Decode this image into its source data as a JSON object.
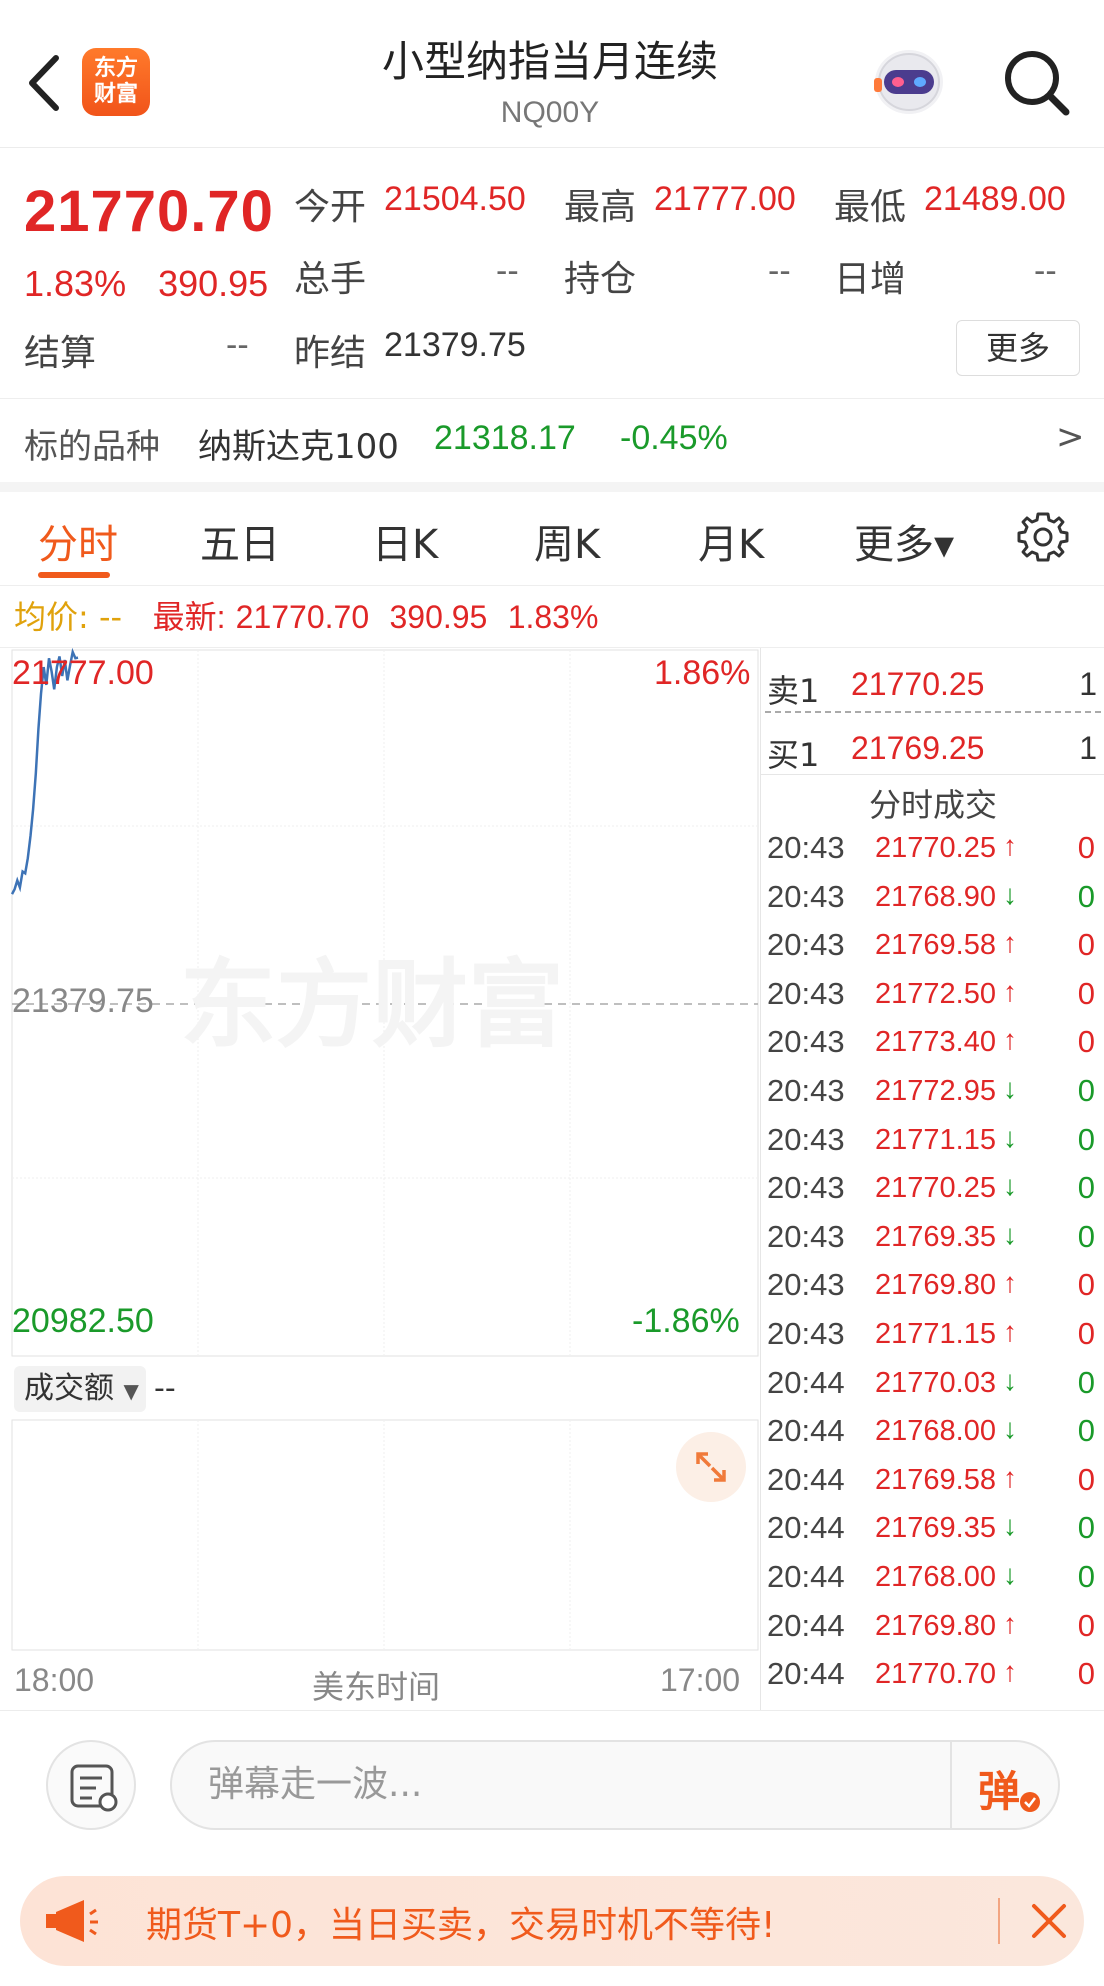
{
  "header": {
    "title": "小型纳指当月连续",
    "subtitle": "NQ00Y",
    "logo_line1": "东方",
    "logo_line2": "财富"
  },
  "quote": {
    "last_price": "21770.70",
    "change_pct": "1.83%",
    "change_abs": "390.95",
    "open_label": "今开",
    "open_value": "21504.50",
    "high_label": "最高",
    "high_value": "21777.00",
    "low_label": "最低",
    "low_value": "21489.00",
    "volume_label": "总手",
    "volume_value": "--",
    "oi_label": "持仓",
    "oi_value": "--",
    "daily_inc_label": "日增",
    "daily_inc_value": "--",
    "settle_label": "结算",
    "settle_value": "--",
    "prev_settle_label": "昨结",
    "prev_settle_value": "21379.75",
    "more_label": "更多"
  },
  "underlying": {
    "label": "标的品种",
    "name": "纳斯达克100",
    "price": "21318.17",
    "change": "-0.45%",
    "arrow": ">"
  },
  "tabs": [
    {
      "label": "分时",
      "active": true
    },
    {
      "label": "五日"
    },
    {
      "label": "日K"
    },
    {
      "label": "周K"
    },
    {
      "label": "月K"
    },
    {
      "label": "更多▾"
    }
  ],
  "avg_line": {
    "avg_label": "均价:",
    "avg_value": "--",
    "latest_label": "最新:",
    "latest_price": "21770.70",
    "latest_change": "390.95",
    "latest_pct": "1.83%"
  },
  "chart": {
    "y_top": "21777.00",
    "y_mid": "21379.75",
    "y_bottom": "20982.50",
    "pct_top": "1.86%",
    "pct_bottom": "-1.86%",
    "watermark": "东方财富",
    "line_color": "#3d73b6"
  },
  "chart_data": {
    "type": "line",
    "title": "",
    "ylim": [
      20982.5,
      21777.0
    ],
    "reference": 21379.75,
    "x": [
      0,
      1,
      2,
      3,
      4,
      5,
      6,
      7,
      8,
      9,
      10,
      11,
      12,
      13,
      14,
      15,
      16,
      17,
      18,
      19,
      20,
      21,
      22,
      23,
      24,
      25
    ],
    "values": [
      21504.5,
      21510,
      21520,
      21512,
      21530,
      21528,
      21545,
      21570,
      21600,
      21640,
      21690,
      21730,
      21760,
      21740,
      21770,
      21755,
      21735,
      21760,
      21772,
      21750,
      21768,
      21745,
      21762,
      21777,
      21770,
      21770.7
    ]
  },
  "volume": {
    "select_label": "成交额",
    "value": "--"
  },
  "time_axis": {
    "start": "18:00",
    "middle": "美东时间",
    "end": "17:00"
  },
  "orderbook": {
    "ask_label": "卖1",
    "ask_price": "21770.25",
    "ask_qty": "1",
    "bid_label": "买1",
    "bid_price": "21769.25",
    "bid_qty": "1"
  },
  "ticks": {
    "title": "分时成交",
    "rows": [
      {
        "time": "20:43",
        "price": "21770.25",
        "dir": "up",
        "vol": "0"
      },
      {
        "time": "20:43",
        "price": "21768.90",
        "dir": "down",
        "vol": "0"
      },
      {
        "time": "20:43",
        "price": "21769.58",
        "dir": "up",
        "vol": "0"
      },
      {
        "time": "20:43",
        "price": "21772.50",
        "dir": "up",
        "vol": "0"
      },
      {
        "time": "20:43",
        "price": "21773.40",
        "dir": "up",
        "vol": "0"
      },
      {
        "time": "20:43",
        "price": "21772.95",
        "dir": "down",
        "vol": "0"
      },
      {
        "time": "20:43",
        "price": "21771.15",
        "dir": "down",
        "vol": "0"
      },
      {
        "time": "20:43",
        "price": "21770.25",
        "dir": "down",
        "vol": "0"
      },
      {
        "time": "20:43",
        "price": "21769.35",
        "dir": "down",
        "vol": "0"
      },
      {
        "time": "20:43",
        "price": "21769.80",
        "dir": "up",
        "vol": "0"
      },
      {
        "time": "20:43",
        "price": "21771.15",
        "dir": "up",
        "vol": "0"
      },
      {
        "time": "20:44",
        "price": "21770.03",
        "dir": "down",
        "vol": "0"
      },
      {
        "time": "20:44",
        "price": "21768.00",
        "dir": "down",
        "vol": "0"
      },
      {
        "time": "20:44",
        "price": "21769.58",
        "dir": "up",
        "vol": "0"
      },
      {
        "time": "20:44",
        "price": "21769.35",
        "dir": "down",
        "vol": "0"
      },
      {
        "time": "20:44",
        "price": "21768.00",
        "dir": "down",
        "vol": "0"
      },
      {
        "time": "20:44",
        "price": "21769.80",
        "dir": "up",
        "vol": "0"
      },
      {
        "time": "20:44",
        "price": "21770.70",
        "dir": "up",
        "vol": "0"
      }
    ]
  },
  "danmu": {
    "placeholder": "弹幕走一波...",
    "button_label": "弹"
  },
  "ad": {
    "text": "期货T+0，当日买卖，交易时机不等待!"
  },
  "colors": {
    "accent": "#f05a1c",
    "up": "#e02626",
    "down": "#1a9a2a"
  }
}
